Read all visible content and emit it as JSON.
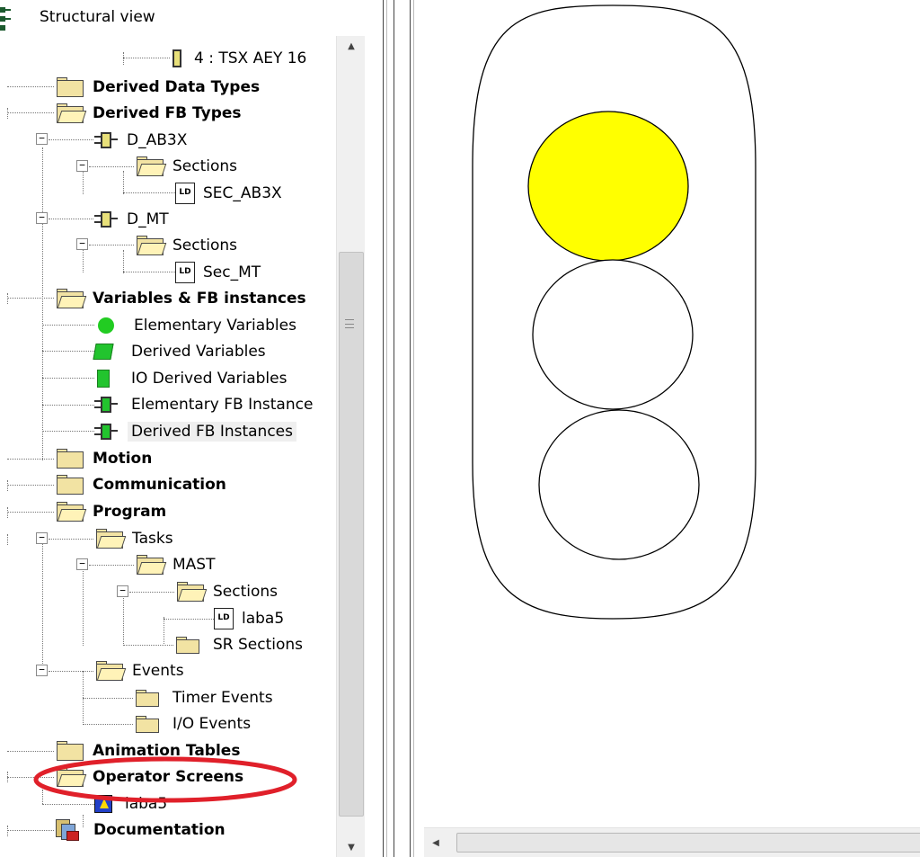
{
  "header": {
    "title": "Structural view"
  },
  "tree": {
    "io_module": "4 : TSX AEY 16",
    "derived_data_types": "Derived Data Types",
    "derived_fb_types": "Derived FB Types",
    "d_ab3x": "D_AB3X",
    "d_ab3x_sections": "Sections",
    "sec_ab3x": "SEC_AB3X",
    "d_mt": "D_MT",
    "d_mt_sections": "Sections",
    "sec_mt": "Sec_MT",
    "variables": "Variables & FB instances",
    "elementary_variables": "Elementary Variables",
    "derived_variables": "Derived Variables",
    "io_derived_variables": "IO Derived Variables",
    "elementary_fb_instances": "Elementary FB Instance",
    "derived_fb_instances": "Derived FB Instances",
    "motion": "Motion",
    "communication": "Communication",
    "program": "Program",
    "tasks": "Tasks",
    "mast": "MAST",
    "mast_sections": "Sections",
    "laba5_section": "laba5",
    "sr_sections": "SR Sections",
    "events": "Events",
    "timer_events": "Timer Events",
    "io_events": "I/O Events",
    "animation_tables": "Animation Tables",
    "operator_screens": "Operator Screens",
    "laba5_screen": "laba5",
    "documentation": "Documentation",
    "ld_badge": "LD"
  },
  "traffic_light": {
    "lamps": [
      {
        "name": "top",
        "fill": "#ffff00",
        "state": "lit"
      },
      {
        "name": "middle",
        "fill": "#ffffff",
        "state": "off"
      },
      {
        "name": "bottom",
        "fill": "#ffffff",
        "state": "off"
      }
    ]
  },
  "colors": {
    "highlight_ellipse": "#e0202a",
    "lamp_on": "#ffff00"
  }
}
